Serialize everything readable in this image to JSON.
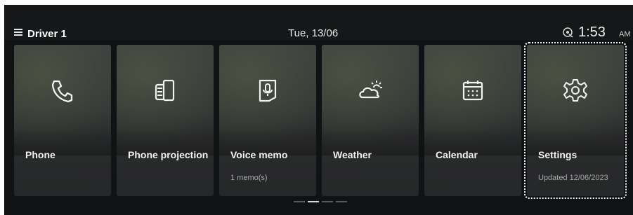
{
  "header": {
    "profile": "Driver 1",
    "date": "Tue, 13/06",
    "time": "1:53",
    "ampm": "AM"
  },
  "icons": {
    "menu": "hamburger-menu-icon",
    "network": "connected-services-icon"
  },
  "cards": [
    {
      "title": "Phone",
      "subtitle": "",
      "icon": "phone-icon"
    },
    {
      "title": "Phone projection",
      "subtitle": "",
      "icon": "phone-projection-icon"
    },
    {
      "title": "Voice memo",
      "subtitle": "1 memo(s)",
      "icon": "voice-memo-icon"
    },
    {
      "title": "Weather",
      "subtitle": "",
      "icon": "weather-icon"
    },
    {
      "title": "Calendar",
      "subtitle": "",
      "icon": "calendar-icon"
    },
    {
      "title": "Settings",
      "subtitle": "Updated 12/06/2023",
      "icon": "gear-icon"
    }
  ],
  "page_indicator": {
    "pages": 4,
    "active": 2
  },
  "colors": {
    "background": "#111213",
    "card": "#333435",
    "text": "#f3f3f3",
    "focus_outline": "#ffffff"
  }
}
